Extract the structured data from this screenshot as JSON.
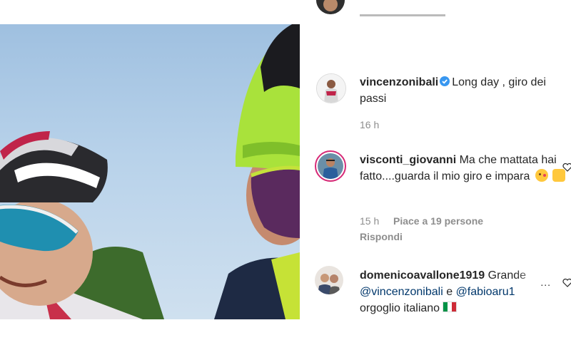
{
  "post": {
    "media": {
      "kind": "video-still",
      "description_icon": "cyclists-selfie"
    }
  },
  "caption": {
    "username": "vincenzonibali",
    "verified": true,
    "text": "Long day , giro dei passi",
    "time": "16 h"
  },
  "comments": [
    {
      "username": "visconti_giovanni",
      "text": "Ma che mattata hai fatto....guarda il mio giro e impara",
      "emoji": [
        "kissing-face",
        "raised-hands"
      ],
      "time": "15 h",
      "likes": "Piace a 19 persone",
      "reply": "Rispondi"
    },
    {
      "username": "domenicoavallone1919",
      "text_lead": "Grande",
      "mention1": "@vincenzonibali",
      "conjunction": "e",
      "mention2": "@fabioaru1",
      "text_tail": "orgoglio italiano",
      "flag": "italy-flag",
      "more": "..."
    }
  ],
  "colors": {
    "text": "#262626",
    "meta": "#8e8e8e",
    "mention": "#00376b",
    "verified": "#3897f0",
    "story_ring": "#d62976"
  }
}
